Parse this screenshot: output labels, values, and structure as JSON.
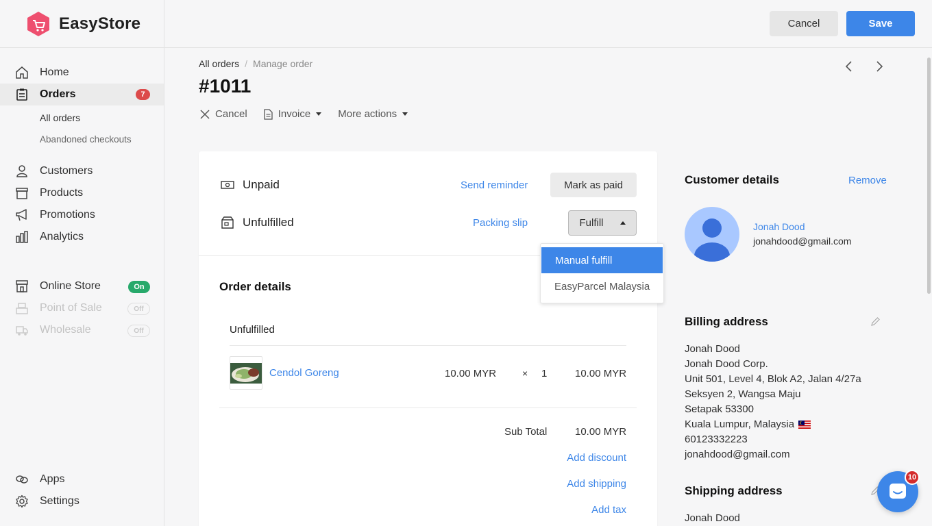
{
  "app": {
    "name": "EasyStore"
  },
  "sidebar": {
    "items": [
      {
        "label": "Home",
        "icon": "home-icon"
      },
      {
        "label": "Orders",
        "icon": "orders-icon",
        "badge": "7"
      },
      {
        "label": "Customers",
        "icon": "user-icon"
      },
      {
        "label": "Products",
        "icon": "box-icon"
      },
      {
        "label": "Promotions",
        "icon": "megaphone-icon"
      },
      {
        "label": "Analytics",
        "icon": "bar-chart-icon"
      }
    ],
    "order_subitems": [
      "All orders",
      "Abandoned checkouts"
    ],
    "channels": [
      {
        "label": "Online Store",
        "status": "On"
      },
      {
        "label": "Point of Sale",
        "status": "Off"
      },
      {
        "label": "Wholesale",
        "status": "Off"
      }
    ],
    "bottom": [
      {
        "label": "Apps",
        "icon": "apps-icon"
      },
      {
        "label": "Settings",
        "icon": "gear-icon"
      }
    ]
  },
  "topbar": {
    "cancel_label": "Cancel",
    "save_label": "Save"
  },
  "breadcrumb": {
    "parent": "All orders",
    "current": "Manage order"
  },
  "order": {
    "number": "#1011",
    "actions": {
      "cancel": "Cancel",
      "invoice": "Invoice",
      "more": "More actions"
    }
  },
  "payment": {
    "status": "Unpaid",
    "link": "Send reminder",
    "button": "Mark as paid"
  },
  "fulfillment": {
    "status": "Unfulfilled",
    "link": "Packing slip",
    "button": "Fulfill",
    "menu": [
      "Manual fulfill",
      "EasyParcel Malaysia"
    ]
  },
  "order_details": {
    "title": "Order details",
    "group": "Unfulfilled",
    "item": {
      "name": "Cendol Goreng",
      "price": "10.00 MYR",
      "times": "×",
      "qty": "1",
      "total": "10.00 MYR"
    },
    "subtotal_label": "Sub Total",
    "subtotal_value": "10.00 MYR",
    "add_discount": "Add discount",
    "add_shipping": "Add shipping",
    "add_tax": "Add tax"
  },
  "customer": {
    "title": "Customer details",
    "remove": "Remove",
    "name": "Jonah Dood",
    "email": "jonahdood@gmail.com"
  },
  "billing": {
    "title": "Billing address",
    "lines": [
      "Jonah Dood",
      "Jonah Dood Corp.",
      "Unit 501, Level 4, Blok A2, Jalan 4/27a",
      "Seksyen 2, Wangsa Maju",
      "Setapak 53300",
      "Kuala Lumpur, Malaysia",
      "60123332223",
      "jonahdood@gmail.com"
    ]
  },
  "shipping": {
    "title": "Shipping address",
    "first_line": "Jonah Dood"
  },
  "chat": {
    "badge": "10"
  },
  "colors": {
    "accent": "#3d86e8",
    "badge_red": "#dc4a4a",
    "on_green": "#27a96b"
  }
}
